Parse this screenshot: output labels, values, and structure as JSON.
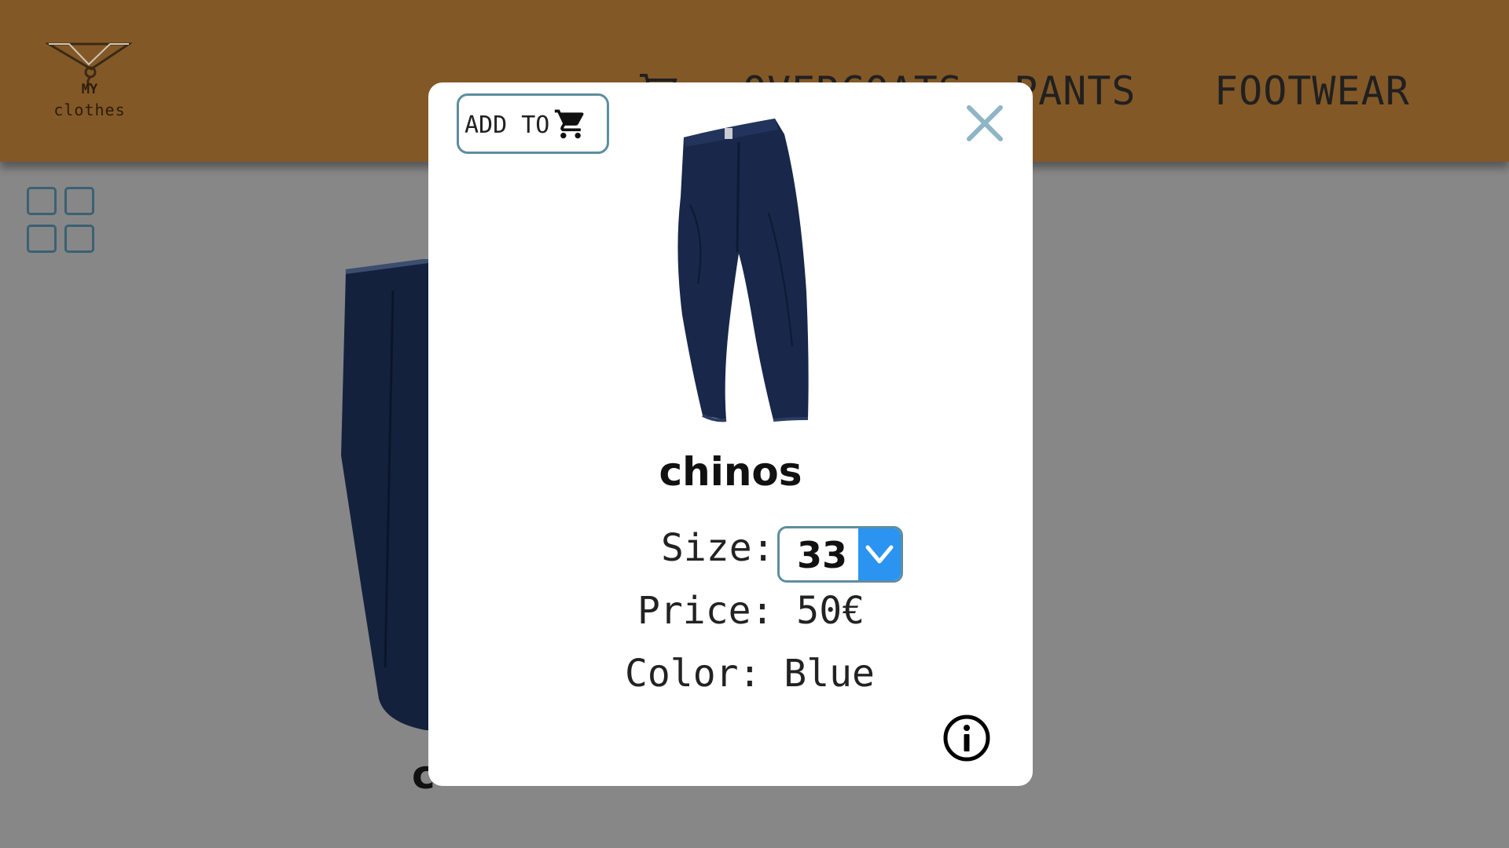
{
  "header": {
    "logo": {
      "line1": "MY",
      "line2": "clothes"
    },
    "nav": {
      "overcoats": "OVERCOATS",
      "pants": "PANTS",
      "footwear": "FOOTWEAR"
    },
    "background_color": "#835827"
  },
  "page": {
    "overlay_color": "#878787",
    "product_name_partial": "c"
  },
  "modal": {
    "add_to_cart_label": "ADD TO",
    "product_name": "chinos",
    "size_label": "Size:",
    "size_value": "33",
    "price_label": "Price:",
    "price_value": "50€",
    "color_label": "Color:",
    "color_value": "Blue",
    "accent_color": "#2b93f0",
    "border_color": "#5e8da0"
  },
  "icons": {
    "cart": "cart-icon",
    "close": "close-icon",
    "info": "info-icon",
    "grid": "grid-view-icon",
    "dropdown": "chevron-down-icon"
  }
}
